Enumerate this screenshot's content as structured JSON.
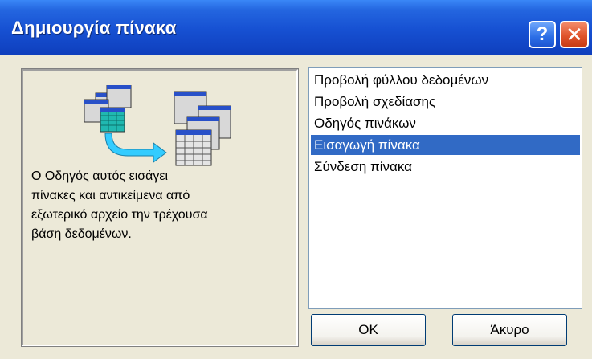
{
  "window": {
    "title": "Δημιουργία πίνακα",
    "help_label": "?",
    "close_label": "✕"
  },
  "description": "Ο Οδηγός αυτός εισάγει\nπίνακες και αντικείμενα από\nεξωτερικό αρχείο την τρέχουσα\nβάση δεδομένων.",
  "options": [
    {
      "label": "Προβολή φύλλου δεδομένων",
      "selected": false
    },
    {
      "label": "Προβολή σχεδίασης",
      "selected": false
    },
    {
      "label": "Οδηγός πινάκων",
      "selected": false
    },
    {
      "label": "Εισαγωγή πίνακα",
      "selected": true
    },
    {
      "label": "Σύνδεση πίνακα",
      "selected": false
    }
  ],
  "buttons": {
    "ok": "OK",
    "cancel": "Άκυρο"
  },
  "colors": {
    "titlebar": "#1650d2",
    "selection": "#316ac5",
    "dialog_bg": "#ece9d8",
    "arrow": "#33ccff"
  },
  "icons": [
    "table-import-illustration-icon",
    "help-icon",
    "close-icon"
  ]
}
